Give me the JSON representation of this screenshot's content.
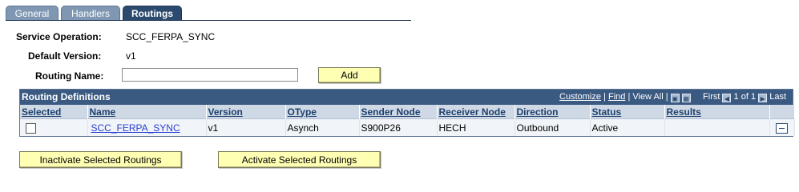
{
  "tabs": [
    {
      "label": "General"
    },
    {
      "label": "Handlers"
    },
    {
      "label": "Routings"
    }
  ],
  "form": {
    "service_operation_label": "Service Operation:",
    "service_operation_value": "SCC_FERPA_SYNC",
    "default_version_label": "Default Version:",
    "default_version_value": "v1",
    "routing_name_label": "Routing Name:",
    "routing_name_value": "",
    "add_label": "Add"
  },
  "grid": {
    "title": "Routing Definitions",
    "customize": "Customize",
    "find": "Find",
    "view_all": "View All",
    "first": "First",
    "range": "1 of 1",
    "last": "Last",
    "columns": [
      "Selected",
      "Name",
      "Version",
      "OType",
      "Sender Node",
      "Receiver Node",
      "Direction",
      "Status",
      "Results"
    ],
    "rows": [
      {
        "name": "SCC_FERPA_SYNC",
        "version": "v1",
        "otype": "Asynch",
        "sender": "S900P26",
        "receiver": "HECH",
        "direction": "Outbound",
        "status": "Active",
        "results": ""
      }
    ]
  },
  "actions": {
    "inactivate": "Inactivate Selected Routings",
    "activate": "Activate Selected Routings"
  },
  "colors": {
    "header": "#3b5a82",
    "button": "#ffffb4",
    "active_tab": "#2c4a6e"
  }
}
